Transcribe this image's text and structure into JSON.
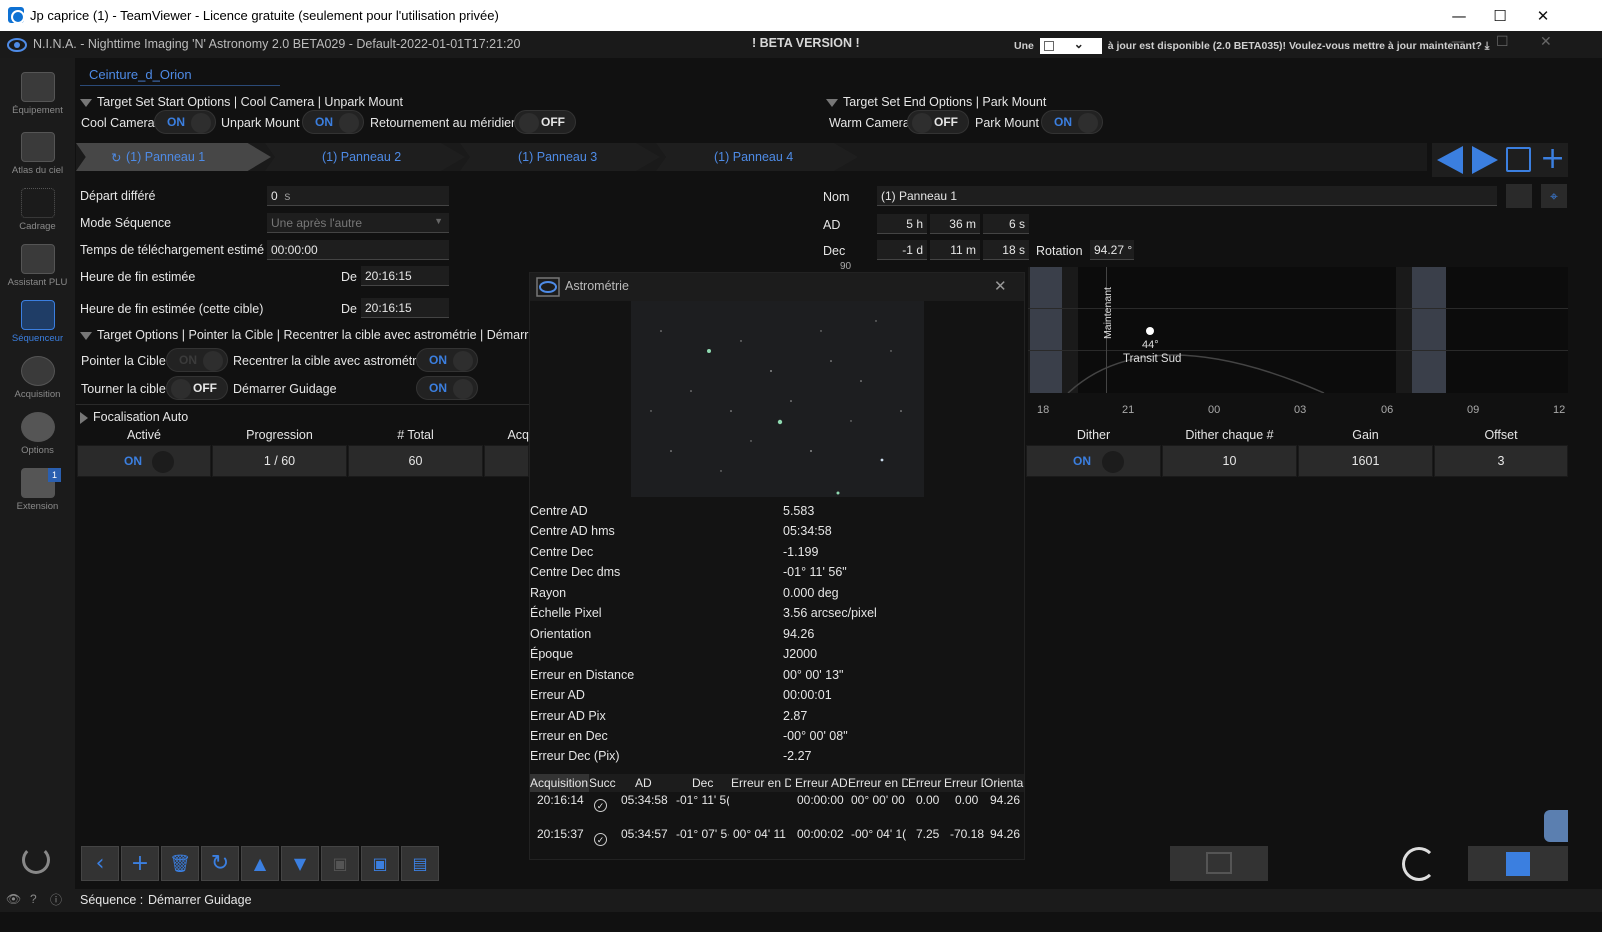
{
  "teamviewer": {
    "title": "Jp caprice (1) - TeamViewer - Licence gratuite (seulement pour l'utilisation privée)",
    "minimize": "—",
    "maximize": "☐",
    "close": "✕"
  },
  "app": {
    "title": "N.I.N.A. - Nighttime Imaging 'N' Astronomy 2.0 BETA029  -  Default-2022-01-01T17:21:20",
    "beta": "! BETA VERSION !",
    "update_left": "Une",
    "update_right": "à jour est disponible (2.0 BETA035)! Voulez-vous mettre à jour maintenant?",
    "minimize": "—",
    "maximize": "☐",
    "close": "✕"
  },
  "nav": [
    {
      "label": "Équipement",
      "icon": "telescope-icon"
    },
    {
      "label": "Atlas du ciel",
      "icon": "sky-atlas-icon"
    },
    {
      "label": "Cadrage",
      "icon": "framing-icon"
    },
    {
      "label": "Assistant PLU",
      "icon": "flat-wizard-icon"
    },
    {
      "label": "Séquenceur",
      "icon": "sequencer-icon"
    },
    {
      "label": "Acquisition",
      "icon": "imaging-icon"
    },
    {
      "label": "Options",
      "icon": "gears-icon"
    },
    {
      "label": "Extension",
      "icon": "puzzle-icon",
      "badge": "1"
    }
  ],
  "target_tab": "Ceinture_d_Orion",
  "start_options": {
    "header": "Target Set Start Options   |  Cool Camera  |  Unpark Mount",
    "cool_camera_label": "Cool Camera",
    "cool_camera": "ON",
    "unpark_label": "Unpark Mount",
    "unpark": "ON",
    "flip_label": "Retournement au méridien",
    "flip": "OFF"
  },
  "end_options": {
    "header": "Target Set End Options  |  Park Mount",
    "warm_label": "Warm Camera",
    "warm": "OFF",
    "park_label": "Park Mount",
    "park": "ON"
  },
  "panels": [
    "(1) Panneau 1",
    "(1) Panneau 2",
    "(1) Panneau 3",
    "(1) Panneau 4"
  ],
  "settings": {
    "delay_label": "Départ différé",
    "delay_value": "0",
    "delay_unit": "s",
    "mode_label": "Mode Séquence",
    "mode_value": "Une après l'autre",
    "download_label": "Temps de téléchargement estimé",
    "download_value": "00:00:00",
    "end_label": "Heure de fin estimée",
    "end_de": "De",
    "end_value": "20:16:15",
    "end_target_label": "Heure de fin estimée (cette cible)",
    "end_target_de": "De",
    "end_target_value": "20:16:15"
  },
  "target_options": {
    "header": "Target Options  |  Pointer la Cible  |  Recentrer la cible avec astrométrie  |  Démarrer Gu",
    "slew_label": "Pointer la Cible",
    "slew": "ON",
    "center_label": "Recentrer la cible avec astrométrie",
    "center": "ON",
    "rotate_label": "Tourner la cible",
    "rotate": "OFF",
    "guide_label": "Démarrer Guidage",
    "guide": "ON"
  },
  "autofocus_header": "Focalisation Auto",
  "target": {
    "name_label": "Nom",
    "name": "(1) Panneau 1",
    "ra_label": "AD",
    "ra_h": "5",
    "ra_h_u": "h",
    "ra_m": "36",
    "ra_m_u": "m",
    "ra_s": "6",
    "ra_s_u": "s",
    "dec_label": "Dec",
    "dec_d": "-1",
    "dec_d_u": "d",
    "dec_m": "11",
    "dec_m_u": "m",
    "dec_s": "18",
    "dec_s_u": "s",
    "rotation_label": "Rotation",
    "rotation": "94.27",
    "rotation_u": "°"
  },
  "altitude_chart": {
    "y_top": "90",
    "now_label": "Maintenant",
    "transit_alt": "44°",
    "transit_label": "Transit Sud",
    "x_ticks": [
      "18",
      "21",
      "00",
      "03",
      "06",
      "09",
      "12"
    ]
  },
  "table": {
    "headers_left": [
      "Activé",
      "Progression",
      "# Total",
      "Acq"
    ],
    "row_left": {
      "active": "ON",
      "progress": "1 / 60",
      "total": "60"
    },
    "headers_right": [
      "Dither",
      "Dither chaque #",
      "Gain",
      "Offset"
    ],
    "row_right": {
      "dither": "ON",
      "dither_every": "10",
      "gain": "1601",
      "offset": "3"
    }
  },
  "astrometry": {
    "title": "Astrométrie",
    "close": "✕",
    "rows": [
      {
        "k": "Centre AD",
        "v": "5.583"
      },
      {
        "k": "Centre AD hms",
        "v": "05:34:58"
      },
      {
        "k": "Centre Dec",
        "v": "-1.199"
      },
      {
        "k": "Centre Dec dms",
        "v": "-01° 11' 56\""
      },
      {
        "k": "Rayon",
        "v": "0.000 deg"
      },
      {
        "k": "Échelle Pixel",
        "v": "3.56 arcsec/pixel"
      },
      {
        "k": "Orientation",
        "v": "94.26"
      },
      {
        "k": "Époque",
        "v": "J2000"
      },
      {
        "k": "Erreur en Distance",
        "v": "00° 00' 13\""
      },
      {
        "k": "Erreur AD",
        "v": "00:00:01"
      },
      {
        "k": "Erreur AD Pix",
        "v": "2.87"
      },
      {
        "k": "Erreur en Dec",
        "v": "-00° 00' 08\""
      },
      {
        "k": "Erreur Dec (Pix)",
        "v": "-2.27"
      }
    ],
    "grid_headers": [
      "Acquisition",
      "Succ",
      "AD",
      "Dec",
      "Erreur en D",
      "Erreur AD",
      "Erreur en D",
      "Erreur A",
      "Erreur D",
      "Orienta"
    ],
    "grid_rows": [
      [
        "20:16:14",
        "✓",
        "05:34:58",
        "-01° 11' 5(",
        "",
        "00:00:00",
        "00° 00' 00",
        "0.00",
        "0.00",
        "94.26"
      ],
      [
        "20:15:37",
        "✓",
        "05:34:57",
        "-01° 07' 5·",
        "00° 04' 11",
        "00:00:02",
        "-00° 04' 1(",
        "7.25",
        "-70.18",
        "94.26"
      ]
    ]
  },
  "status": {
    "label": "Séquence :",
    "value": "Démarrer Guidage"
  },
  "colors": {
    "accent": "#3b7fe0",
    "background": "#111111",
    "panel": "#2a2a2a"
  }
}
